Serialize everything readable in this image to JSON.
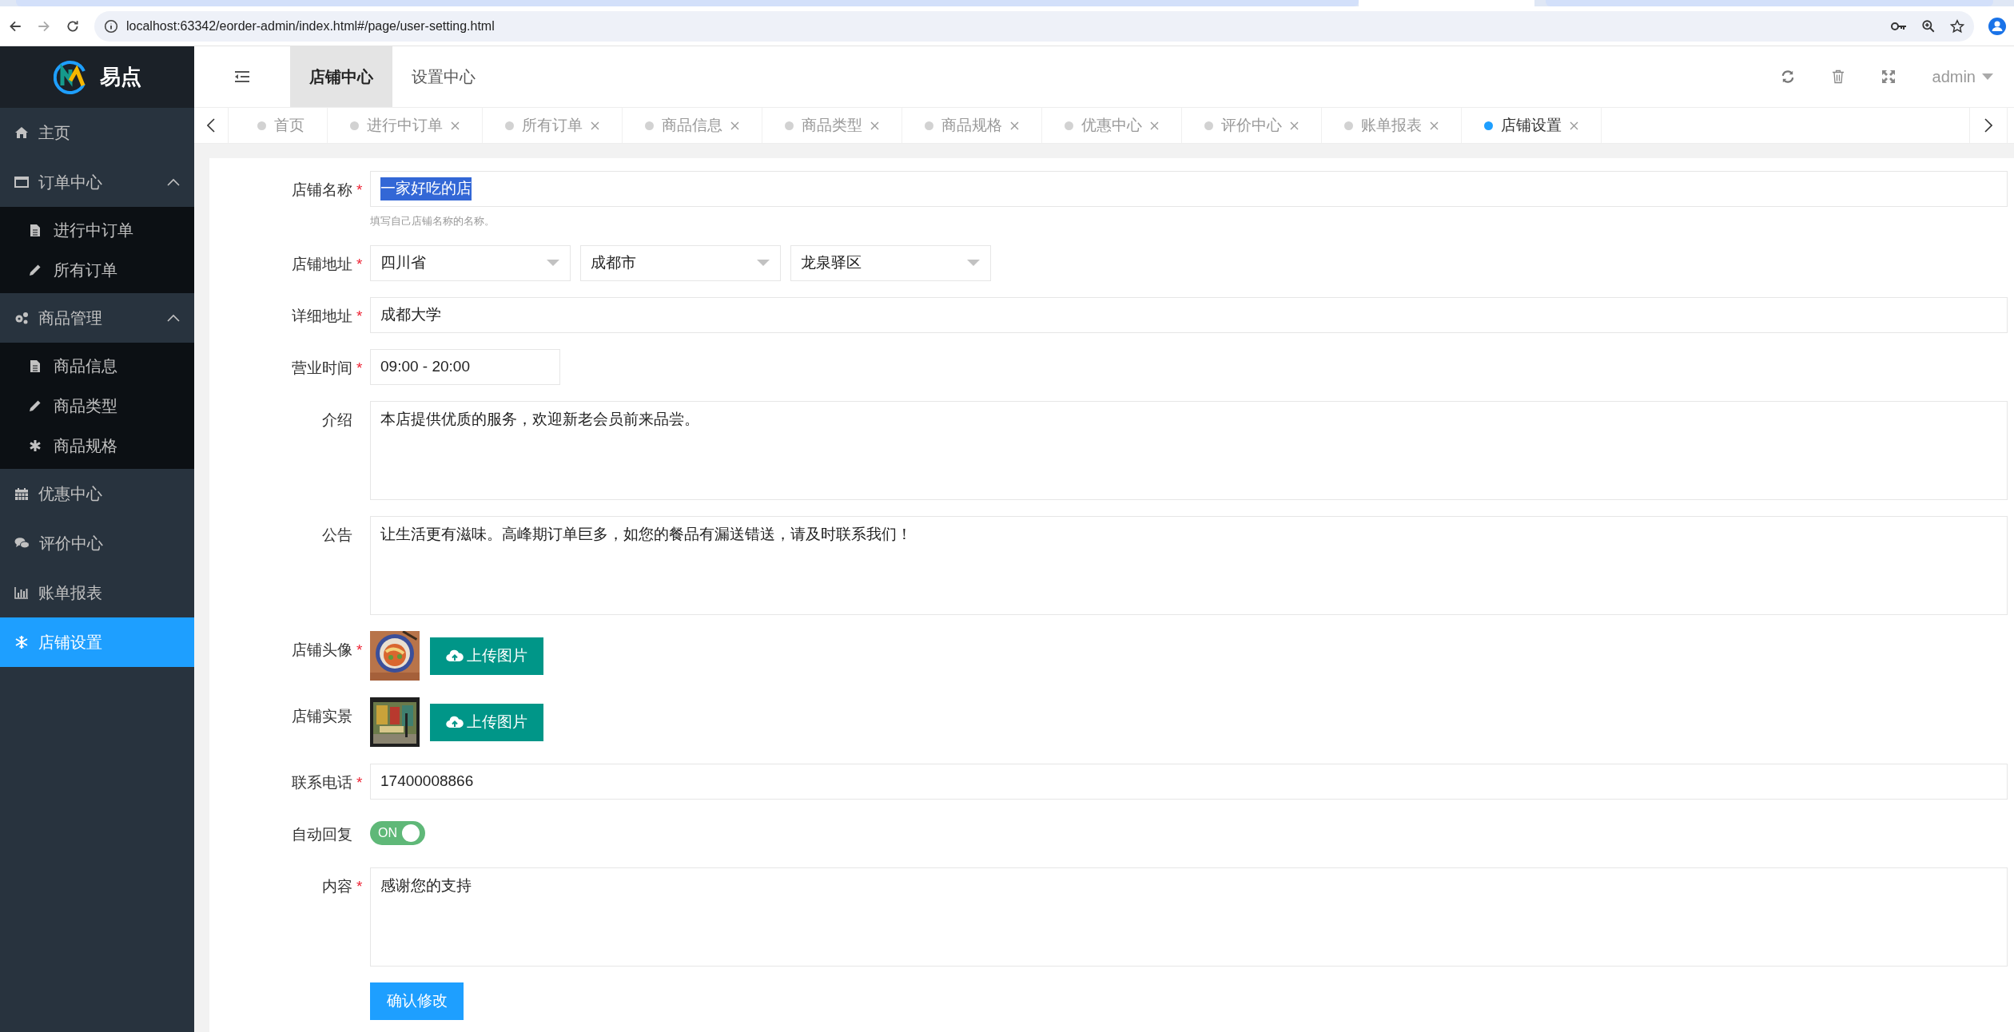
{
  "browser": {
    "tabs": [
      {
        "selected": false
      },
      {
        "selected": true
      },
      {
        "selected": false
      }
    ],
    "url": "localhost:63342/eorder-admin/index.html#/page/user-setting.html"
  },
  "sidebar": {
    "logo": "易点",
    "items": [
      {
        "label": "主页",
        "selected": false
      },
      {
        "label": "订单中心",
        "selected": false,
        "expanded": true,
        "children": [
          {
            "label": "进行中订单",
            "selected": false
          },
          {
            "label": "所有订单",
            "selected": false
          }
        ]
      },
      {
        "label": "商品管理",
        "selected": false,
        "expanded": true,
        "children": [
          {
            "label": "商品信息",
            "selected": false
          },
          {
            "label": "商品类型",
            "selected": false
          },
          {
            "label": "商品规格",
            "selected": false
          }
        ]
      },
      {
        "label": "优惠中心",
        "selected": false
      },
      {
        "label": "评价中心",
        "selected": false
      },
      {
        "label": "账单报表",
        "selected": false
      },
      {
        "label": "店铺设置",
        "selected": true
      }
    ]
  },
  "header": {
    "top_tabs": [
      {
        "label": "店铺中心",
        "selected": true
      },
      {
        "label": "设置中心",
        "selected": false
      }
    ],
    "user": "admin"
  },
  "page_tabs": [
    {
      "label": "首页",
      "selected": false,
      "closable": false
    },
    {
      "label": "进行中订单",
      "selected": false,
      "closable": true
    },
    {
      "label": "所有订单",
      "selected": false,
      "closable": true
    },
    {
      "label": "商品信息",
      "selected": false,
      "closable": true
    },
    {
      "label": "商品类型",
      "selected": false,
      "closable": true
    },
    {
      "label": "商品规格",
      "selected": false,
      "closable": true
    },
    {
      "label": "优惠中心",
      "selected": false,
      "closable": true
    },
    {
      "label": "评价中心",
      "selected": false,
      "closable": true
    },
    {
      "label": "账单报表",
      "selected": false,
      "closable": true
    },
    {
      "label": "店铺设置",
      "selected": true,
      "closable": true
    }
  ],
  "form": {
    "fields": [
      {
        "kind": "text",
        "label": "店铺名称",
        "required_mark": "*",
        "value": "一家好吃的店",
        "highlighted": true,
        "hint": "填写自己店铺名称的名称。"
      },
      {
        "kind": "selects",
        "label": "店铺地址",
        "required_mark": "*",
        "values": [
          "四川省",
          "成都市",
          "龙泉驿区"
        ]
      },
      {
        "kind": "text",
        "label": "详细地址",
        "required_mark": "*",
        "value": "成都大学",
        "highlighted": false
      },
      {
        "kind": "time",
        "label": "营业时间",
        "required_mark": "*",
        "value": "09:00 - 20:00"
      },
      {
        "kind": "textarea",
        "label": "介绍",
        "value": "本店提供优质的服务，欢迎新老会员前来品尝。"
      },
      {
        "kind": "textarea",
        "label": "公告",
        "value": "让生活更有滋味。高峰期订单巨多，如您的餐品有漏送错送，请及时联系我们！"
      },
      {
        "label": "店铺头像",
        "required_mark": "*",
        "button": "上传图片"
      },
      {
        "label": "店铺实景",
        "button": "上传图片"
      },
      {
        "kind": "text",
        "label": "联系电话",
        "required_mark": "*",
        "value": "17400008866",
        "highlighted": false
      },
      {
        "kind": "toggle",
        "label": "自动回复",
        "on": true,
        "text": "ON"
      },
      {
        "kind": "textarea",
        "label": "内容",
        "required_mark": "*",
        "value": "感谢您的支持"
      }
    ],
    "submit": "确认修改"
  }
}
